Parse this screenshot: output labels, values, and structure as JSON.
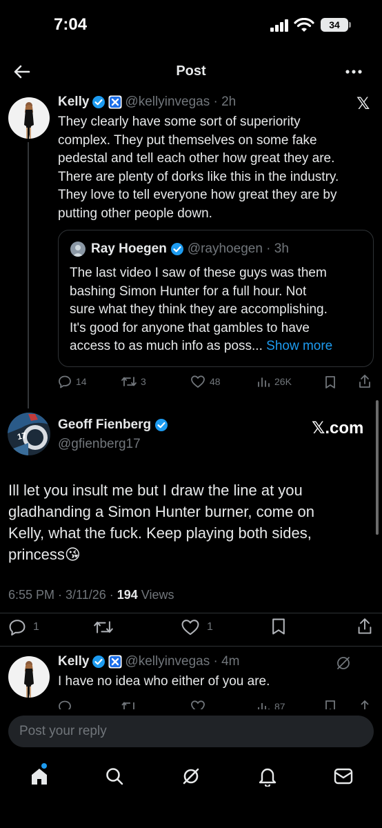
{
  "status": {
    "time": "7:04",
    "battery": "34"
  },
  "header": {
    "title": "Post"
  },
  "tweet1": {
    "name": "Kelly",
    "handle_time": "@kellyinvegas · 2h",
    "lines": [
      "They clearly have some sort of superiority",
      "complex. They put themselves on some fake",
      "pedestal and tell each other how great they are.",
      "There are plenty of dorks like this in the industry.",
      "They love to tell everyone how great they are by",
      "putting other people down."
    ],
    "quote": {
      "name": "Ray Hoegen",
      "handle_time": "@rayhoegen · 3h",
      "lines": [
        "The last video I saw of these guys was them",
        "bashing Simon Hunter for a full hour.  Not",
        "sure what they think they are accomplishing.",
        "It's good for anyone that gambles to have"
      ],
      "last_line": "access to as much info as poss...",
      "show_more": "Show more"
    },
    "stats": {
      "replies": "14",
      "reposts": "3",
      "likes": "48",
      "views": "26K"
    }
  },
  "main_post": {
    "name": "Geoff Fienberg",
    "handle": "@gfienberg17",
    "avatar_text": "17",
    "source_label": "𝕏.com",
    "lines": [
      "Ill let you insult me but I draw the line at you",
      "gladhanding a Simon Hunter burner, come on",
      "Kelly, what the fuck. Keep playing both sides,"
    ],
    "last_line": "princess😘",
    "timestamp": "6:55 PM · 3/11/26 · ",
    "views_count": "194",
    "views_label": " Views",
    "stats": {
      "replies": "1",
      "likes": "1"
    }
  },
  "reply1": {
    "name": "Kelly",
    "handle_time": "@kellyinvegas · 4m",
    "text": "I have no idea who either of you are.",
    "views": "87"
  },
  "composer": {
    "placeholder": "Post your reply"
  },
  "colors": {
    "accent": "#1d9bf0",
    "muted": "#71767b",
    "text": "#e7e9ea",
    "border": "#2f3336"
  }
}
